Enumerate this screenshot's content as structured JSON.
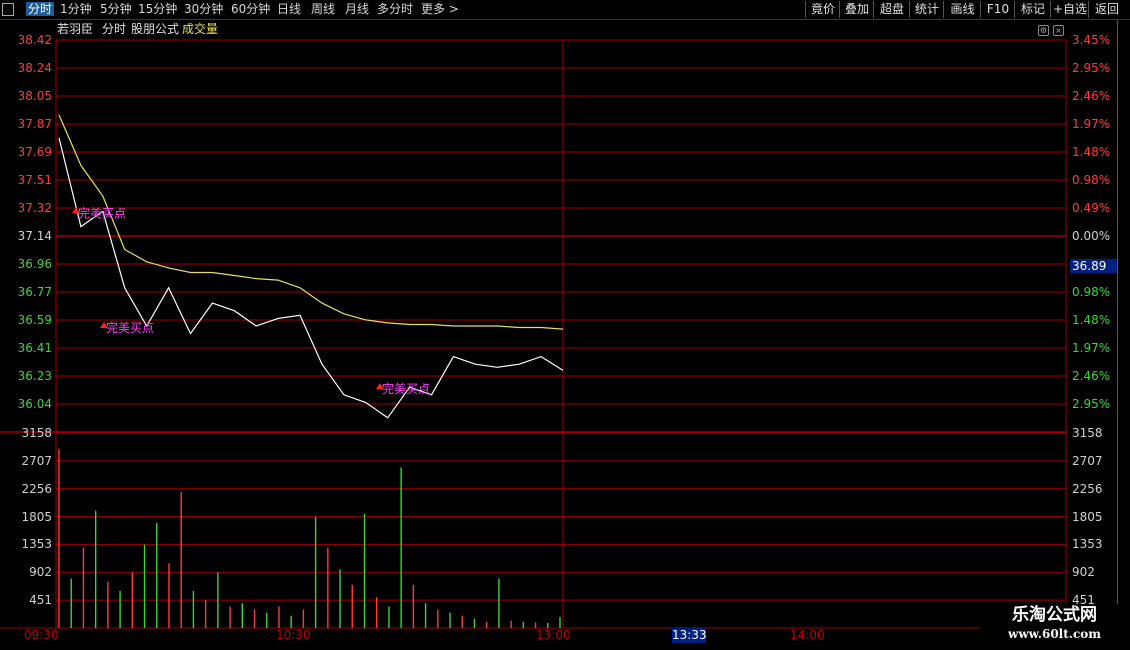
{
  "toolbar": {
    "tabs": [
      "分时",
      "1分钟",
      "5分钟",
      "15分钟",
      "30分钟",
      "60分钟",
      "日线",
      "周线",
      "月线",
      "多分时",
      "更多 >"
    ],
    "active_tab": "分时",
    "right_buttons": [
      "竟价",
      "叠加",
      "超盘",
      "统计",
      "画线",
      "F10",
      "标记",
      "+自选",
      "返回"
    ]
  },
  "subhead": {
    "stock_name": "若羽臣",
    "view": "分时",
    "formula": "股朋公式",
    "volume_label": "成交量"
  },
  "colors": {
    "up": "#ff3b3b",
    "down": "#3cd33c",
    "grid": "#a00000",
    "price_line": "#ffffff",
    "avg_line": "#e6e060",
    "signal": "#ff40ff",
    "highlight_bg": "#002080"
  },
  "price_axis": {
    "left_labels": [
      "38.42",
      "38.24",
      "38.05",
      "37.87",
      "37.69",
      "37.51",
      "37.32",
      "37.14",
      "36.96",
      "36.77",
      "36.59",
      "36.41",
      "36.23",
      "36.04"
    ],
    "right_labels": [
      "3.45%",
      "2.95%",
      "2.46%",
      "1.97%",
      "1.48%",
      "0.98%",
      "0.49%",
      "0.00%",
      "0.49%",
      "0.98%",
      "1.48%",
      "1.97%",
      "2.46%",
      "2.95%"
    ],
    "baseline": "37.14"
  },
  "volume_axis": {
    "labels": [
      "3158",
      "2707",
      "2256",
      "1805",
      "1353",
      "902",
      "451"
    ]
  },
  "time_axis": {
    "labels": [
      "09:30",
      "10:30",
      "13:00",
      "14:00"
    ],
    "cursor_time": "13:33"
  },
  "cursor_price": "36.89",
  "signals": [
    {
      "label": "完美买点"
    },
    {
      "label": "完美买点"
    },
    {
      "label": "完美买点"
    }
  ],
  "watermark": {
    "line1": "乐淘公式网",
    "line2": "www.60lt.com"
  },
  "chart_data": {
    "type": "line",
    "title": "",
    "xlabel": "",
    "ylabel": "",
    "ylim": [
      36.04,
      38.42
    ],
    "prev_close": 37.14,
    "x": [
      "09:30",
      "09:34",
      "09:38",
      "09:42",
      "09:46",
      "09:50",
      "09:54",
      "10:00",
      "10:06",
      "10:12",
      "10:18",
      "10:24",
      "10:30",
      "10:36",
      "10:42",
      "10:48",
      "10:54",
      "11:00",
      "11:06",
      "11:12",
      "11:18",
      "11:24",
      "11:30",
      "13:00"
    ],
    "series": [
      {
        "name": "",
        "values": [
          37.78,
          37.2,
          37.3,
          36.8,
          36.55,
          36.8,
          36.5,
          36.7,
          36.65,
          36.55,
          36.6,
          36.62,
          36.3,
          36.1,
          36.05,
          35.95,
          36.15,
          36.1,
          36.35,
          36.3,
          36.28,
          36.3,
          36.35,
          36.26
        ]
      },
      {
        "name": "",
        "values": [
          37.93,
          37.6,
          37.4,
          37.05,
          36.97,
          36.93,
          36.9,
          36.9,
          36.88,
          36.86,
          36.85,
          36.8,
          36.7,
          36.63,
          36.59,
          36.57,
          36.56,
          36.56,
          36.55,
          36.55,
          36.55,
          36.54,
          36.54,
          36.53
        ]
      }
    ],
    "volume_ylim": [
      0,
      3158
    ],
    "volume": [
      {
        "x": 0,
        "v": 2900,
        "d": "up"
      },
      {
        "x": 1,
        "v": 800,
        "d": "down"
      },
      {
        "x": 2,
        "v": 1300,
        "d": "up"
      },
      {
        "x": 3,
        "v": 1900,
        "d": "down"
      },
      {
        "x": 4,
        "v": 750,
        "d": "up"
      },
      {
        "x": 5,
        "v": 600,
        "d": "down"
      },
      {
        "x": 6,
        "v": 900,
        "d": "up"
      },
      {
        "x": 7,
        "v": 1350,
        "d": "down"
      },
      {
        "x": 8,
        "v": 1700,
        "d": "down"
      },
      {
        "x": 9,
        "v": 1050,
        "d": "up"
      },
      {
        "x": 10,
        "v": 2200,
        "d": "up"
      },
      {
        "x": 11,
        "v": 600,
        "d": "down"
      },
      {
        "x": 12,
        "v": 450,
        "d": "up"
      },
      {
        "x": 13,
        "v": 900,
        "d": "down"
      },
      {
        "x": 14,
        "v": 350,
        "d": "up"
      },
      {
        "x": 15,
        "v": 400,
        "d": "down"
      },
      {
        "x": 16,
        "v": 300,
        "d": "up"
      },
      {
        "x": 17,
        "v": 250,
        "d": "down"
      },
      {
        "x": 18,
        "v": 350,
        "d": "up"
      },
      {
        "x": 19,
        "v": 200,
        "d": "down"
      },
      {
        "x": 20,
        "v": 300,
        "d": "up"
      },
      {
        "x": 21,
        "v": 1800,
        "d": "down"
      },
      {
        "x": 22,
        "v": 1300,
        "d": "up"
      },
      {
        "x": 23,
        "v": 950,
        "d": "down"
      },
      {
        "x": 24,
        "v": 700,
        "d": "up"
      },
      {
        "x": 25,
        "v": 1850,
        "d": "down"
      },
      {
        "x": 26,
        "v": 500,
        "d": "up"
      },
      {
        "x": 27,
        "v": 350,
        "d": "down"
      },
      {
        "x": 28,
        "v": 2600,
        "d": "down"
      },
      {
        "x": 29,
        "v": 700,
        "d": "up"
      },
      {
        "x": 30,
        "v": 400,
        "d": "down"
      },
      {
        "x": 31,
        "v": 300,
        "d": "up"
      },
      {
        "x": 32,
        "v": 250,
        "d": "down"
      },
      {
        "x": 33,
        "v": 200,
        "d": "up"
      },
      {
        "x": 34,
        "v": 150,
        "d": "down"
      },
      {
        "x": 35,
        "v": 100,
        "d": "up"
      },
      {
        "x": 36,
        "v": 800,
        "d": "down"
      },
      {
        "x": 37,
        "v": 120,
        "d": "up"
      },
      {
        "x": 38,
        "v": 100,
        "d": "down"
      },
      {
        "x": 39,
        "v": 90,
        "d": "up"
      },
      {
        "x": 40,
        "v": 80,
        "d": "down"
      },
      {
        "x": 41,
        "v": 180,
        "d": "down"
      }
    ],
    "signals": [
      {
        "x": "09:35",
        "y": 37.3,
        "label": "完美买点"
      },
      {
        "x": "09:43",
        "y": 36.55,
        "label": "完美买点"
      },
      {
        "x": "10:52",
        "y": 36.15,
        "label": "完美买点"
      }
    ]
  }
}
